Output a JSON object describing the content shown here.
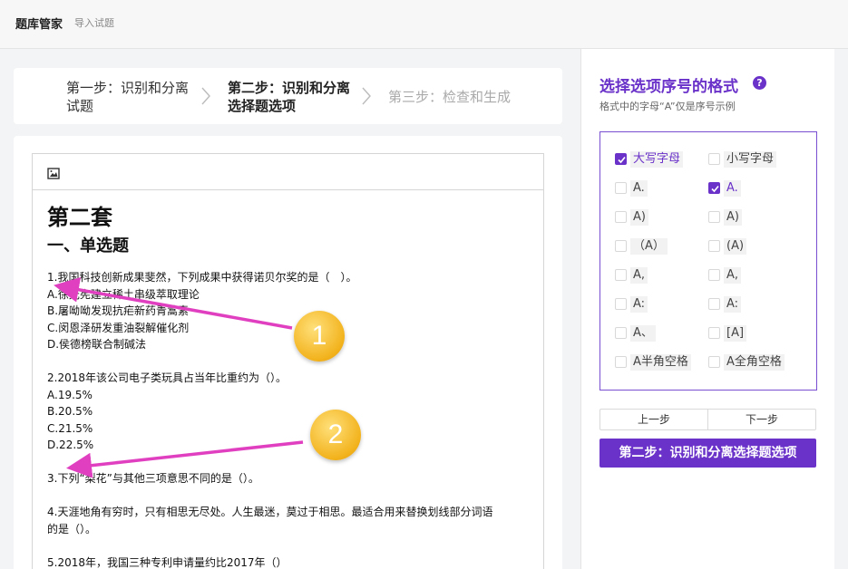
{
  "header": {
    "title": "题库管家",
    "subtitle": "导入试题"
  },
  "steps": [
    {
      "label": "第一步：识别和分离试题",
      "state": "done"
    },
    {
      "label": "第二步：识别和分离选择题选项",
      "state": "active"
    },
    {
      "label": "第三步：检查和生成",
      "state": "pending"
    }
  ],
  "editor": {
    "toolbar_icon": "image-icon",
    "heading1": "第二套",
    "heading2": "一、单选题",
    "lines": [
      "1.我国科技创新成果斐然，下列成果中获得诺贝尔奖的是（　）。",
      "A.徐光宪建立稀土串级萃取理论",
      "B.屠呦呦发现抗疟新药青蒿素",
      "C.闵恩泽研发重油裂解催化剂",
      "D.侯德榜联合制碱法",
      "",
      "2.2018年该公司电子类玩具占当年比重约为（）。",
      "A.19.5%",
      "B.20.5%",
      "C.21.5%",
      "D.22.5%",
      "",
      "3.下列“梨花”与其他三项意思不同的是（）。",
      "",
      "4.天涯地角有穷时，只有相思无尽处。人生最迷，莫过于相思。最适合用来替换划线部分词语",
      "的是（）。",
      "",
      "5.2018年，我国三种专利申请量约比2017年（）"
    ]
  },
  "annotations": {
    "badge1": "1",
    "badge2": "2",
    "arrow_color": "#e040c0"
  },
  "panel": {
    "title": "选择选项序号的格式",
    "help_icon": "question-icon",
    "hint": "格式中的字母“A”仅是序号示例",
    "options": [
      {
        "label": "大写字母",
        "checked": true
      },
      {
        "label": "小写字母",
        "checked": false
      },
      {
        "label": "A.",
        "checked": false
      },
      {
        "label": "A.",
        "checked": true
      },
      {
        "label": "A)",
        "checked": false
      },
      {
        "label": "A)",
        "checked": false
      },
      {
        "label": "（A）",
        "checked": false
      },
      {
        "label": "(A)",
        "checked": false
      },
      {
        "label": "A,",
        "checked": false
      },
      {
        "label": "A,",
        "checked": false
      },
      {
        "label": "A:",
        "checked": false
      },
      {
        "label": "A:",
        "checked": false
      },
      {
        "label": "A、",
        "checked": false
      },
      {
        "label": "[A]",
        "checked": false
      },
      {
        "label": "A半角空格",
        "checked": false
      },
      {
        "label": "A全角空格",
        "checked": false
      }
    ],
    "prev_label": "上一步",
    "next_label": "下一步",
    "primary_label": "第二步：识别和分离选择题选项"
  },
  "colors": {
    "accent": "#6a32c9",
    "badge": "#f2b21c"
  }
}
